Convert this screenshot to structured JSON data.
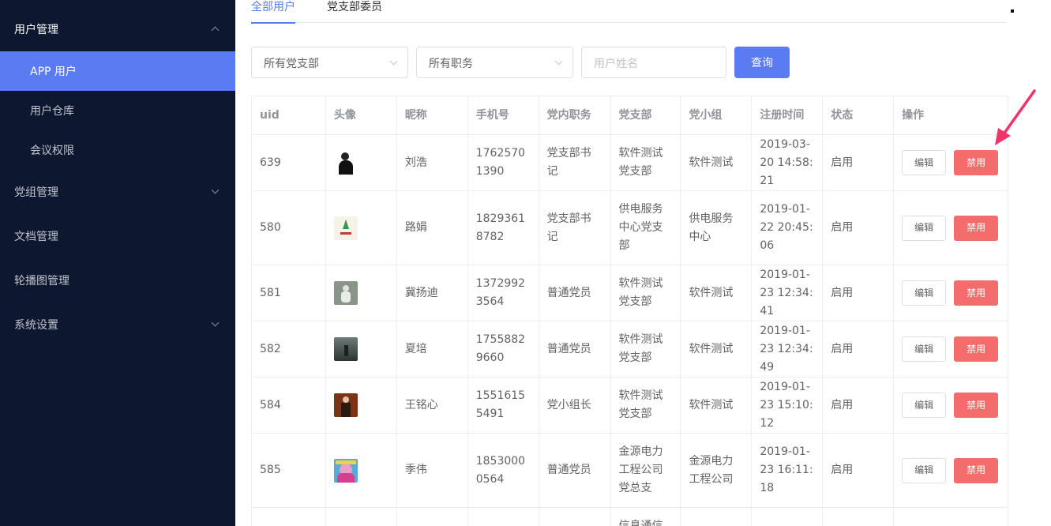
{
  "sidebar": {
    "items": [
      {
        "label": "用户管理",
        "state": "expanded"
      },
      {
        "label": "APP 用户",
        "state": "active"
      },
      {
        "label": "用户仓库"
      },
      {
        "label": "会议权限"
      },
      {
        "label": "党组管理",
        "state": "collapsed"
      },
      {
        "label": "文档管理"
      },
      {
        "label": "轮播图管理"
      },
      {
        "label": "系统设置",
        "state": "collapsed"
      }
    ]
  },
  "tabs": [
    {
      "label": "全部用户",
      "active": true
    },
    {
      "label": "党支部委员",
      "active": false
    }
  ],
  "filters": {
    "branch_select": "所有党支部",
    "position_select": "所有职务",
    "name_placeholder": "用户姓名",
    "query_label": "查询"
  },
  "table": {
    "headers": [
      "uid",
      "头像",
      "昵称",
      "手机号",
      "党内职务",
      "党支部",
      "党小组",
      "注册时间",
      "状态",
      "操作"
    ],
    "edit_label": "编辑",
    "disable_label": "禁用",
    "rows": [
      {
        "uid": "639",
        "nickname": "刘浩",
        "phone": "17625701390",
        "position": "党支部书记",
        "branch": "软件测试党支部",
        "group": "软件测试",
        "registered": "2019-03-20 14:58:21",
        "status": "启用",
        "avatar": "dark-figure"
      },
      {
        "uid": "580",
        "nickname": "路娟",
        "phone": "18293618782",
        "position": "党支部书记",
        "branch": "供电服务中心党支部",
        "group": "供电服务中心",
        "registered": "2019-01-22 20:45:06",
        "status": "启用",
        "avatar": "green-logo"
      },
      {
        "uid": "581",
        "nickname": "冀扬迪",
        "phone": "13729923564",
        "position": "普通党员",
        "branch": "软件测试党支部",
        "group": "软件测试",
        "registered": "2019-01-23 12:34:41",
        "status": "启用",
        "avatar": "gray-figure"
      },
      {
        "uid": "582",
        "nickname": "夏培",
        "phone": "17558829660",
        "position": "普通党员",
        "branch": "软件测试党支部",
        "group": "软件测试",
        "registered": "2019-01-23 12:34:49",
        "status": "启用",
        "avatar": "dusk-landscape"
      },
      {
        "uid": "584",
        "nickname": "王铭心",
        "phone": "15516155491",
        "position": "党小组长",
        "branch": "软件测试党支部",
        "group": "软件测试",
        "registered": "2019-01-23 15:10:12",
        "status": "启用",
        "avatar": "brown-portrait"
      },
      {
        "uid": "585",
        "nickname": "季伟",
        "phone": "18530000564",
        "position": "普通党员",
        "branch": "金源电力工程公司党总支",
        "group": "金源电力工程公司",
        "registered": "2019-01-23 16:11:18",
        "status": "启用",
        "avatar": "colorful-cartoon"
      },
      {
        "uid": "",
        "nickname": "",
        "phone": "",
        "position": "",
        "branch": "信息通信",
        "group": "",
        "registered": "",
        "status": "",
        "avatar": ""
      }
    ]
  },
  "colors": {
    "sidebar_bg": "#0e1730",
    "accent": "#5b7bf3",
    "danger": "#f56c6c",
    "annotation": "#f0336b"
  },
  "icons": {
    "expand_icon": "chevron-up-icon",
    "collapse_icon": "chevron-down-icon",
    "select_arrow": "chevron-down-icon"
  }
}
